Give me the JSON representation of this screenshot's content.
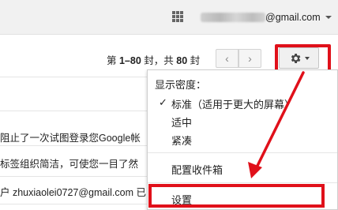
{
  "header": {
    "account_email_suffix": "@gmail.com",
    "apps_icon": "apps-grid-icon"
  },
  "toolbar": {
    "pager_prefix": "第 ",
    "pager_range": "1–80",
    "pager_mid": " 封，共 ",
    "pager_total": "80",
    "pager_suffix": " 封",
    "prev_glyph": "‹",
    "next_glyph": "›"
  },
  "mail_rows": [
    {
      "text": "阻止了一次试图登录您Google帐"
    },
    {
      "text": "标签组织简洁，可使您一目了然"
    },
    {
      "text": "户 zhuxiaolei0727@gmail.com 已"
    }
  ],
  "menu": {
    "density_header": "显示密度：",
    "density_standard": "标准（适用于更大的屏幕）",
    "density_comfortable": "适中",
    "density_compact": "紧凑",
    "configure_inbox": "配置收件箱",
    "settings": "设置",
    "checkmark": "✓"
  },
  "colors": {
    "highlight": "#e0101a",
    "topbar_bg": "#f1f1f1"
  }
}
